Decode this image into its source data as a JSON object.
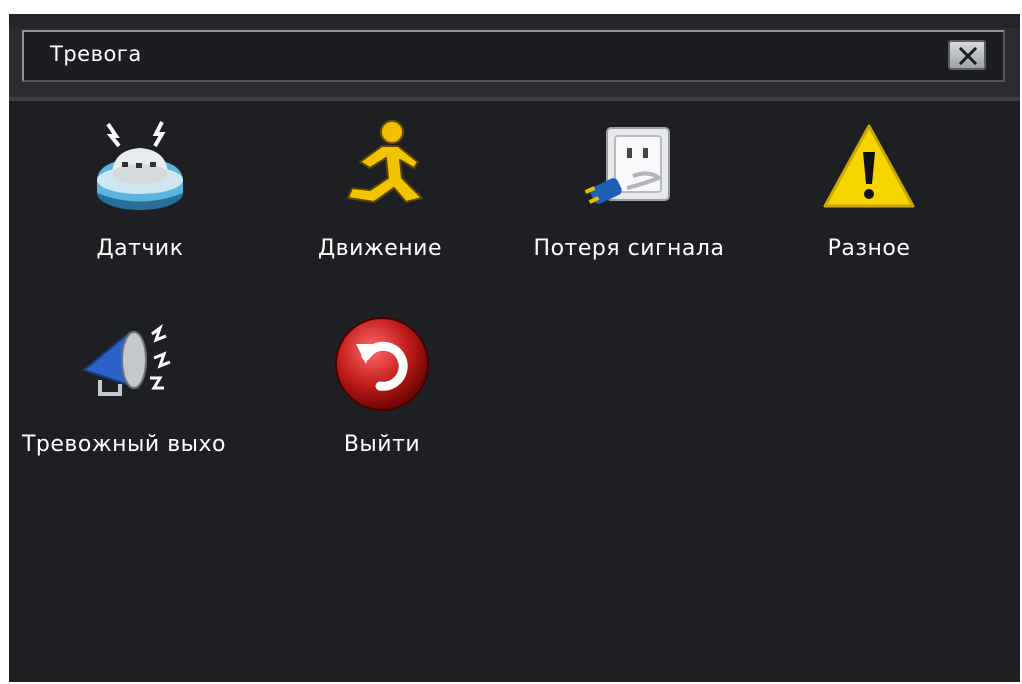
{
  "window": {
    "title": "Тревога",
    "close_icon": "close-x-icon"
  },
  "menu": {
    "items": [
      {
        "label": "Датчик",
        "icon": "smoke-sensor-icon"
      },
      {
        "label": "Движение",
        "icon": "running-man-icon"
      },
      {
        "label": "Потеря сигнала",
        "icon": "unplugged-socket-icon"
      },
      {
        "label": "Разное",
        "icon": "warning-triangle-icon"
      },
      {
        "label": "Тревожный выхо",
        "icon": "megaphone-icon"
      },
      {
        "label": "Выйти",
        "icon": "exit-undo-icon"
      }
    ]
  },
  "colors": {
    "background": "#1e1f23",
    "text": "#ffffff",
    "warning_yellow": "#f5d400",
    "exit_red": "#c21a1a"
  }
}
